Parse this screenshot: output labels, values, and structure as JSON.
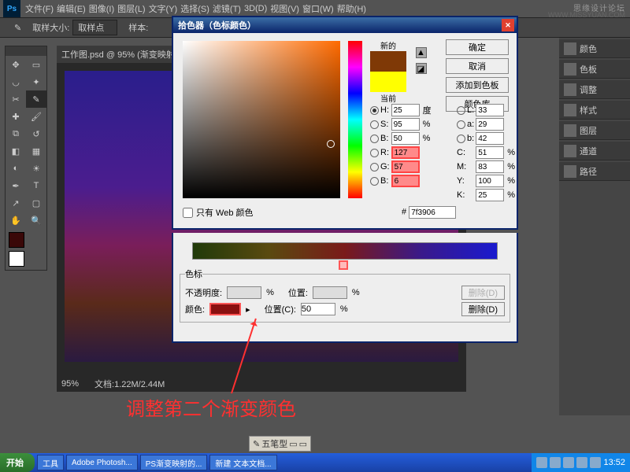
{
  "menu": {
    "items": [
      "文件(F)",
      "编辑(E)",
      "图像(I)",
      "图层(L)",
      "文字(Y)",
      "选择(S)",
      "滤镜(T)",
      "3D(D)",
      "视图(V)",
      "窗口(W)",
      "帮助(H)"
    ]
  },
  "watermark": "思缘设计论坛",
  "watermark2": "WWW.MISSYUAN.COM",
  "optbar": {
    "label1": "取样大小:",
    "value1": "取样点",
    "label2": "样本:"
  },
  "doc": {
    "tab": "工作图.psd @ 95% (渐变映射",
    "zoom": "95%",
    "info": "文档:1.22M/2.44M"
  },
  "picker": {
    "title": "拾色器（色标颜色）",
    "new": "新的",
    "current": "当前",
    "buttons": {
      "ok": "确定",
      "cancel": "取消",
      "add": "添加到色板",
      "lib": "颜色库"
    },
    "H": "25",
    "Hd": "度",
    "S": "95",
    "B": "50",
    "L": "33",
    "a": "29",
    "b": "42",
    "R": "127",
    "G": "57",
    "Bb": "6",
    "C": "51",
    "M": "83",
    "Y": "100",
    "K": "25",
    "pct": "%",
    "hexlabel": "#",
    "hex": "7f3906",
    "web": "只有 Web 颜色"
  },
  "grad": {
    "stops": "色标",
    "opacity": "不透明度:",
    "pos": "位置:",
    "del": "删除(D)",
    "color": "颜色:",
    "posC": "位置(C):",
    "posval": "50"
  },
  "panels": [
    "颜色",
    "色板",
    "调整",
    "样式",
    "图层",
    "通道",
    "路径"
  ],
  "annot": "调整第二个渐变颜色",
  "ime": "五笔型",
  "taskbar": {
    "start": "开始",
    "items": [
      "工具",
      "Adobe Photosh...",
      "PS渐变映射的...",
      "新建 文本文档..."
    ],
    "time": "13:52"
  }
}
